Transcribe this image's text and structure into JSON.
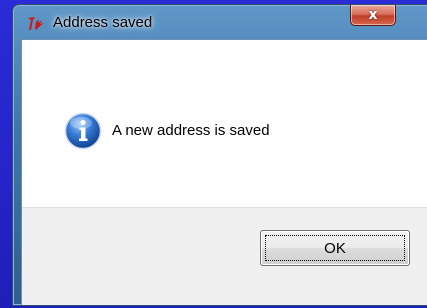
{
  "window": {
    "title": "Address saved",
    "close_glyph": "x"
  },
  "message": {
    "text": "A new address is saved",
    "icon": "info-icon"
  },
  "buttons": {
    "ok_label": "OK"
  },
  "colors": {
    "desktop": "#2a2ad0",
    "title_bar": "#3f77ab",
    "close_button": "#c0402a",
    "info_icon": "#1f5fb8"
  }
}
